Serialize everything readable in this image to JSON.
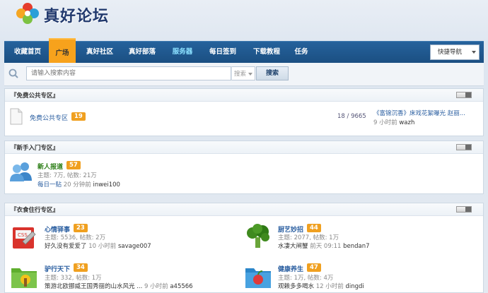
{
  "site": {
    "logo_text": "真好论坛"
  },
  "nav": {
    "items": [
      {
        "label": "收藏首页"
      },
      {
        "label": "广场"
      },
      {
        "label": "真好社区"
      },
      {
        "label": "真好部落"
      },
      {
        "label": "服务器"
      },
      {
        "label": "每日签到"
      },
      {
        "label": "下载教程"
      },
      {
        "label": "任务"
      }
    ],
    "quick_nav": "快捷导航"
  },
  "search": {
    "placeholder": "请输入搜索内容",
    "type": "搜索",
    "button": "搜索"
  },
  "sections": [
    {
      "title": "『免费公共专区』",
      "forums": [
        {
          "name": "免费公共专区",
          "badge": "19",
          "stats": "18 / 9665",
          "last_title": "《富锦沉香》床戏花絮曝光 赵丽...",
          "last_time": "9 小时前",
          "last_user": "wazh"
        }
      ]
    },
    {
      "title": "『新手入门专区』",
      "forums": [
        {
          "name": "新人报道",
          "badge": "57",
          "stats": "主题: 7万, 帖数: 21万",
          "last_title": "每日一贴",
          "last_time": "20 分钟前",
          "last_user": "inwei100"
        }
      ]
    },
    {
      "title": "『衣食住行专区』",
      "forums": [
        {
          "name": "心情驿事",
          "badge": "23",
          "stats": "主题: 5536, 帖数: 2万",
          "last_title": "好久没有爱爱了",
          "last_time": "10 小时前",
          "last_user": "savage007"
        },
        {
          "name": "厨艺妙招",
          "badge": "44",
          "stats": "主题: 2077, 帖数: 1万",
          "last_title": "水凄大闸蟹",
          "last_time": "前天 09:11",
          "last_user": "bendan7"
        },
        {
          "name": "驴行天下",
          "badge": "34",
          "stats": "主题: 332, 帖数: 1万",
          "last_title": "策游北欧挪威王国秀丽的山水风光 ...",
          "last_time": "9 小时前",
          "last_user": "a45566"
        },
        {
          "name": "健康养生",
          "badge": "47",
          "stats": "主题: 1万, 帖数: 4万",
          "last_title": "观赖多多喝水",
          "last_time": "12 小时前",
          "last_user": "dingdi"
        }
      ]
    }
  ],
  "colors": {
    "nav_bg": "#1f5a91",
    "nav_active": "#f7a21c",
    "link_blue": "#2a5ea0",
    "badge": "#f0a020"
  }
}
